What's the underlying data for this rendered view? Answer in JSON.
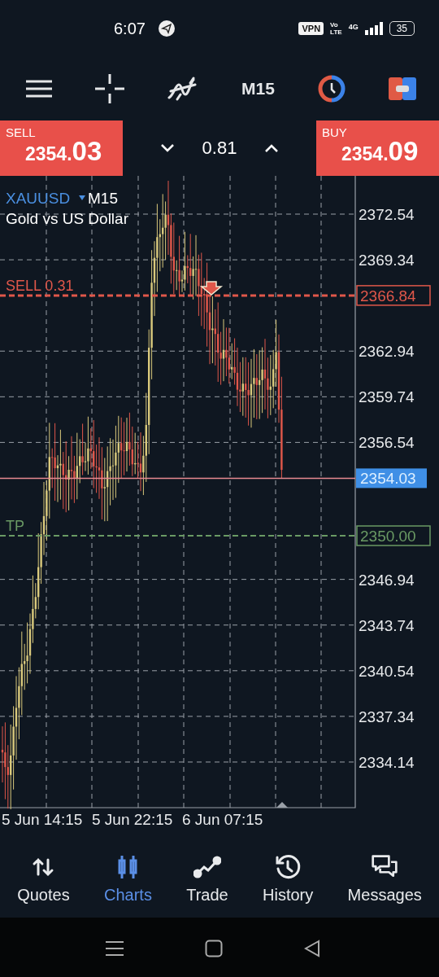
{
  "status_bar": {
    "time": "6:07",
    "vpn": "VPN",
    "volte_top": "Vo",
    "volte_bottom": "LTE",
    "network": "4G",
    "battery": "35"
  },
  "toolbar": {
    "timeframe": "M15"
  },
  "trade_bar": {
    "sell": {
      "label": "SELL",
      "price_small": "2354.",
      "price_big": "03"
    },
    "volume": "0.81",
    "buy": {
      "label": "BUY",
      "price_small": "2354.",
      "price_big": "09"
    }
  },
  "chart": {
    "symbol": "XAUUSD",
    "timeframe": "M15",
    "description": "Gold vs US Dollar",
    "price_ticks": [
      "2372.54",
      "2369.34",
      "2362.94",
      "2359.74",
      "2356.54",
      "2346.94",
      "2343.74",
      "2340.54",
      "2337.34",
      "2334.14"
    ],
    "order_line": {
      "label": "SELL 0.31",
      "price": "2366.84"
    },
    "current_price": "2354.03",
    "take_profit": {
      "label": "TP",
      "price": "2350.00"
    },
    "time_labels": [
      "5 Jun 14:15",
      "5 Jun 22:15",
      "6 Jun 07:15"
    ]
  },
  "bottom_nav": [
    {
      "kind": "quotes",
      "label": "Quotes",
      "selected": false
    },
    {
      "kind": "charts",
      "label": "Charts",
      "selected": true
    },
    {
      "kind": "trade",
      "label": "Trade",
      "selected": false
    },
    {
      "kind": "history",
      "label": "History",
      "selected": false
    },
    {
      "kind": "messages",
      "label": "Messages",
      "selected": false
    }
  ]
}
